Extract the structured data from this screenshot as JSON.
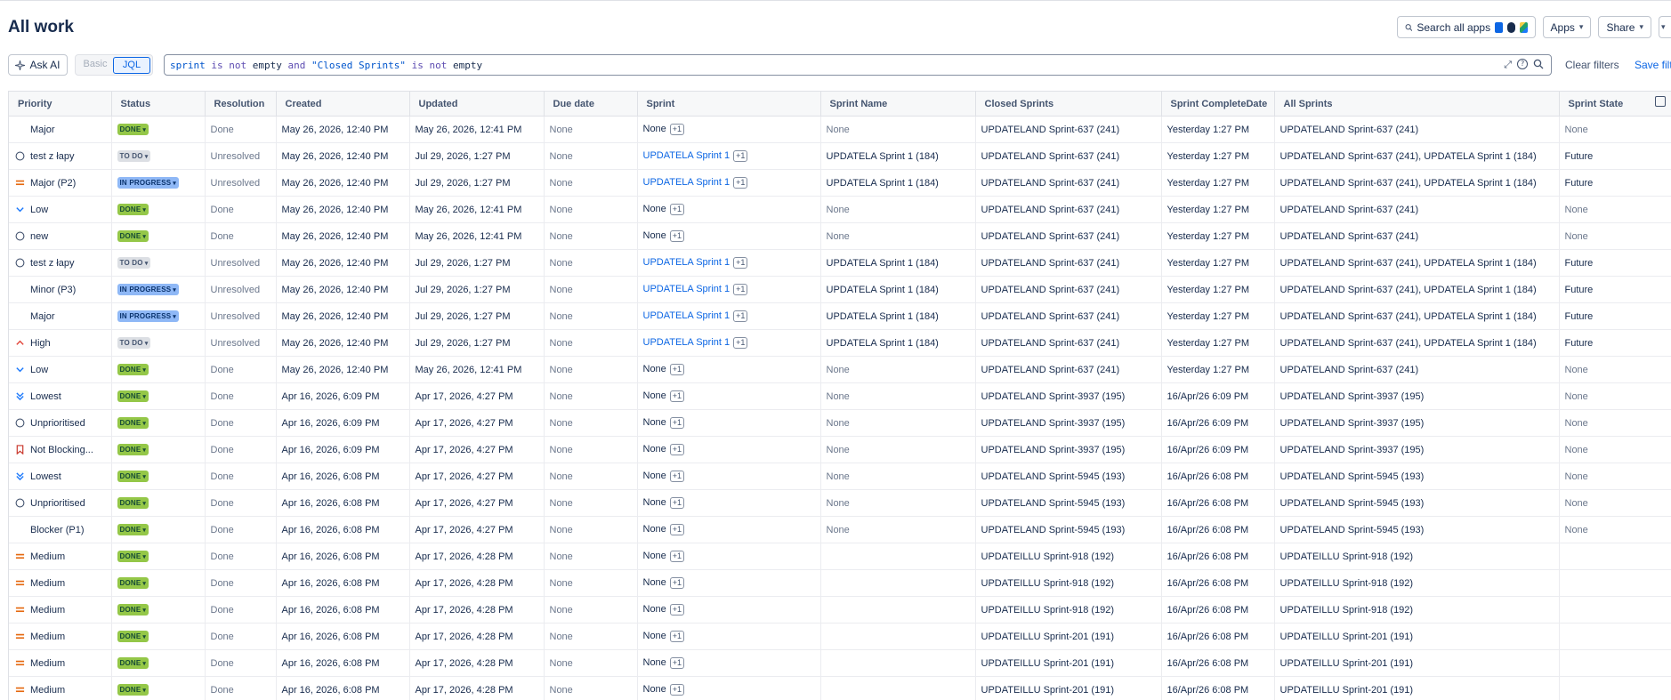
{
  "header": {
    "title": "All work"
  },
  "top_actions": {
    "search_label": "Search all apps",
    "apps_label": "Apps",
    "share_label": "Share"
  },
  "toolbar": {
    "ask_ai_label": "Ask AI",
    "basic_label": "Basic",
    "jql_label": "JQL",
    "query": {
      "t1": "sprint",
      "t2": "is not",
      "t3": "empty",
      "t4": "and",
      "t5": "\"Closed Sprints\"",
      "t6": "is not",
      "t7": "empty"
    },
    "clear_filters_label": "Clear filters",
    "save_filter_label": "Save filter"
  },
  "colors": {
    "accent": "#0c66e4",
    "done": "#94c748",
    "todo": "#dcdfe4",
    "in_progress": "#8fb8f6"
  },
  "table": {
    "columns": [
      "Priority",
      "Status",
      "Resolution",
      "Created",
      "Updated",
      "Due date",
      "Sprint",
      "Sprint Name",
      "Closed Sprints",
      "Sprint CompleteDate",
      "All Sprints",
      "Sprint State"
    ],
    "rows": [
      {
        "icon": "none",
        "priority": "Major",
        "status": "DONE",
        "resolution": "Done",
        "created": "May 26, 2026, 12:40 PM",
        "updated": "May 26, 2026, 12:41 PM",
        "due": "None",
        "sprint": "None",
        "sprint_more": "+1",
        "sprint_name": "None",
        "closed": "UPDATELAND Sprint-637 (241)",
        "complete": "Yesterday 1:27 PM",
        "all": "UPDATELAND Sprint-637 (241)",
        "state": "None"
      },
      {
        "icon": "circle",
        "priority": "test z łapy",
        "status": "TO DO",
        "resolution": "Unresolved",
        "created": "May 26, 2026, 12:40 PM",
        "updated": "Jul 29, 2026, 1:27 PM",
        "due": "None",
        "sprint": "UPDATELA Sprint 1",
        "sprint_more": "+1",
        "sprint_name": "UPDATELA Sprint 1 (184)",
        "closed": "UPDATELAND Sprint-637 (241)",
        "complete": "Yesterday 1:27 PM",
        "all": "UPDATELAND Sprint-637 (241), UPDATELA Sprint 1 (184)",
        "state": "Future"
      },
      {
        "icon": "medium",
        "priority": "Major (P2)",
        "status": "IN PROGRESS",
        "resolution": "Unresolved",
        "created": "May 26, 2026, 12:40 PM",
        "updated": "Jul 29, 2026, 1:27 PM",
        "due": "None",
        "sprint": "UPDATELA Sprint 1",
        "sprint_more": "+1",
        "sprint_name": "UPDATELA Sprint 1 (184)",
        "closed": "UPDATELAND Sprint-637 (241)",
        "complete": "Yesterday 1:27 PM",
        "all": "UPDATELAND Sprint-637 (241), UPDATELA Sprint 1 (184)",
        "state": "Future"
      },
      {
        "icon": "low",
        "priority": "Low",
        "status": "DONE",
        "resolution": "Done",
        "created": "May 26, 2026, 12:40 PM",
        "updated": "May 26, 2026, 12:41 PM",
        "due": "None",
        "sprint": "None",
        "sprint_more": "+1",
        "sprint_name": "None",
        "closed": "UPDATELAND Sprint-637 (241)",
        "complete": "Yesterday 1:27 PM",
        "all": "UPDATELAND Sprint-637 (241)",
        "state": "None"
      },
      {
        "icon": "circle",
        "priority": "new",
        "status": "DONE",
        "resolution": "Done",
        "created": "May 26, 2026, 12:40 PM",
        "updated": "May 26, 2026, 12:41 PM",
        "due": "None",
        "sprint": "None",
        "sprint_more": "+1",
        "sprint_name": "None",
        "closed": "UPDATELAND Sprint-637 (241)",
        "complete": "Yesterday 1:27 PM",
        "all": "UPDATELAND Sprint-637 (241)",
        "state": "None"
      },
      {
        "icon": "circle",
        "priority": "test z łapy",
        "status": "TO DO",
        "resolution": "Unresolved",
        "created": "May 26, 2026, 12:40 PM",
        "updated": "Jul 29, 2026, 1:27 PM",
        "due": "None",
        "sprint": "UPDATELA Sprint 1",
        "sprint_more": "+1",
        "sprint_name": "UPDATELA Sprint 1 (184)",
        "closed": "UPDATELAND Sprint-637 (241)",
        "complete": "Yesterday 1:27 PM",
        "all": "UPDATELAND Sprint-637 (241), UPDATELA Sprint 1 (184)",
        "state": "Future"
      },
      {
        "icon": "none",
        "priority": "Minor (P3)",
        "status": "IN PROGRESS",
        "resolution": "Unresolved",
        "created": "May 26, 2026, 12:40 PM",
        "updated": "Jul 29, 2026, 1:27 PM",
        "due": "None",
        "sprint": "UPDATELA Sprint 1",
        "sprint_more": "+1",
        "sprint_name": "UPDATELA Sprint 1 (184)",
        "closed": "UPDATELAND Sprint-637 (241)",
        "complete": "Yesterday 1:27 PM",
        "all": "UPDATELAND Sprint-637 (241), UPDATELA Sprint 1 (184)",
        "state": "Future"
      },
      {
        "icon": "none",
        "priority": "Major",
        "status": "IN PROGRESS",
        "resolution": "Unresolved",
        "created": "May 26, 2026, 12:40 PM",
        "updated": "Jul 29, 2026, 1:27 PM",
        "due": "None",
        "sprint": "UPDATELA Sprint 1",
        "sprint_more": "+1",
        "sprint_name": "UPDATELA Sprint 1 (184)",
        "closed": "UPDATELAND Sprint-637 (241)",
        "complete": "Yesterday 1:27 PM",
        "all": "UPDATELAND Sprint-637 (241), UPDATELA Sprint 1 (184)",
        "state": "Future"
      },
      {
        "icon": "high",
        "priority": "High",
        "status": "TO DO",
        "resolution": "Unresolved",
        "created": "May 26, 2026, 12:40 PM",
        "updated": "Jul 29, 2026, 1:27 PM",
        "due": "None",
        "sprint": "UPDATELA Sprint 1",
        "sprint_more": "+1",
        "sprint_name": "UPDATELA Sprint 1 (184)",
        "closed": "UPDATELAND Sprint-637 (241)",
        "complete": "Yesterday 1:27 PM",
        "all": "UPDATELAND Sprint-637 (241), UPDATELA Sprint 1 (184)",
        "state": "Future"
      },
      {
        "icon": "low",
        "priority": "Low",
        "status": "DONE",
        "resolution": "Done",
        "created": "May 26, 2026, 12:40 PM",
        "updated": "May 26, 2026, 12:41 PM",
        "due": "None",
        "sprint": "None",
        "sprint_more": "+1",
        "sprint_name": "None",
        "closed": "UPDATELAND Sprint-637 (241)",
        "complete": "Yesterday 1:27 PM",
        "all": "UPDATELAND Sprint-637 (241)",
        "state": "None"
      },
      {
        "icon": "lowest",
        "priority": "Lowest",
        "status": "DONE",
        "resolution": "Done",
        "created": "Apr 16, 2026, 6:09 PM",
        "updated": "Apr 17, 2026, 4:27 PM",
        "due": "None",
        "sprint": "None",
        "sprint_more": "+1",
        "sprint_name": "None",
        "closed": "UPDATELAND Sprint-3937 (195)",
        "complete": "16/Apr/26 6:09 PM",
        "all": "UPDATELAND Sprint-3937 (195)",
        "state": "None"
      },
      {
        "icon": "circle",
        "priority": "Unprioritised",
        "status": "DONE",
        "resolution": "Done",
        "created": "Apr 16, 2026, 6:09 PM",
        "updated": "Apr 17, 2026, 4:27 PM",
        "due": "None",
        "sprint": "None",
        "sprint_more": "+1",
        "sprint_name": "None",
        "closed": "UPDATELAND Sprint-3937 (195)",
        "complete": "16/Apr/26 6:09 PM",
        "all": "UPDATELAND Sprint-3937 (195)",
        "state": "None"
      },
      {
        "icon": "blocking",
        "priority": "Not Blocking...",
        "status": "DONE",
        "resolution": "Done",
        "created": "Apr 16, 2026, 6:09 PM",
        "updated": "Apr 17, 2026, 4:27 PM",
        "due": "None",
        "sprint": "None",
        "sprint_more": "+1",
        "sprint_name": "None",
        "closed": "UPDATELAND Sprint-3937 (195)",
        "complete": "16/Apr/26 6:09 PM",
        "all": "UPDATELAND Sprint-3937 (195)",
        "state": "None"
      },
      {
        "icon": "lowest",
        "priority": "Lowest",
        "status": "DONE",
        "resolution": "Done",
        "created": "Apr 16, 2026, 6:08 PM",
        "updated": "Apr 17, 2026, 4:27 PM",
        "due": "None",
        "sprint": "None",
        "sprint_more": "+1",
        "sprint_name": "None",
        "closed": "UPDATELAND Sprint-5945 (193)",
        "complete": "16/Apr/26 6:08 PM",
        "all": "UPDATELAND Sprint-5945 (193)",
        "state": "None"
      },
      {
        "icon": "circle",
        "priority": "Unprioritised",
        "status": "DONE",
        "resolution": "Done",
        "created": "Apr 16, 2026, 6:08 PM",
        "updated": "Apr 17, 2026, 4:27 PM",
        "due": "None",
        "sprint": "None",
        "sprint_more": "+1",
        "sprint_name": "None",
        "closed": "UPDATELAND Sprint-5945 (193)",
        "complete": "16/Apr/26 6:08 PM",
        "all": "UPDATELAND Sprint-5945 (193)",
        "state": "None"
      },
      {
        "icon": "none",
        "priority": "Blocker (P1)",
        "status": "DONE",
        "resolution": "Done",
        "created": "Apr 16, 2026, 6:08 PM",
        "updated": "Apr 17, 2026, 4:27 PM",
        "due": "None",
        "sprint": "None",
        "sprint_more": "+1",
        "sprint_name": "None",
        "closed": "UPDATELAND Sprint-5945 (193)",
        "complete": "16/Apr/26 6:08 PM",
        "all": "UPDATELAND Sprint-5945 (193)",
        "state": "None"
      },
      {
        "icon": "medium",
        "priority": "Medium",
        "status": "DONE",
        "resolution": "Done",
        "created": "Apr 16, 2026, 6:08 PM",
        "updated": "Apr 17, 2026, 4:28 PM",
        "due": "None",
        "sprint": "None",
        "sprint_more": "+1",
        "sprint_name": "",
        "closed": "UPDATEILLU Sprint-918 (192)",
        "complete": "16/Apr/26 6:08 PM",
        "all": "UPDATEILLU Sprint-918 (192)",
        "state": ""
      },
      {
        "icon": "medium",
        "priority": "Medium",
        "status": "DONE",
        "resolution": "Done",
        "created": "Apr 16, 2026, 6:08 PM",
        "updated": "Apr 17, 2026, 4:28 PM",
        "due": "None",
        "sprint": "None",
        "sprint_more": "+1",
        "sprint_name": "",
        "closed": "UPDATEILLU Sprint-918 (192)",
        "complete": "16/Apr/26 6:08 PM",
        "all": "UPDATEILLU Sprint-918 (192)",
        "state": ""
      },
      {
        "icon": "medium",
        "priority": "Medium",
        "status": "DONE",
        "resolution": "Done",
        "created": "Apr 16, 2026, 6:08 PM",
        "updated": "Apr 17, 2026, 4:28 PM",
        "due": "None",
        "sprint": "None",
        "sprint_more": "+1",
        "sprint_name": "",
        "closed": "UPDATEILLU Sprint-918 (192)",
        "complete": "16/Apr/26 6:08 PM",
        "all": "UPDATEILLU Sprint-918 (192)",
        "state": ""
      },
      {
        "icon": "medium",
        "priority": "Medium",
        "status": "DONE",
        "resolution": "Done",
        "created": "Apr 16, 2026, 6:08 PM",
        "updated": "Apr 17, 2026, 4:28 PM",
        "due": "None",
        "sprint": "None",
        "sprint_more": "+1",
        "sprint_name": "",
        "closed": "UPDATEILLU Sprint-201 (191)",
        "complete": "16/Apr/26 6:08 PM",
        "all": "UPDATEILLU Sprint-201 (191)",
        "state": ""
      },
      {
        "icon": "medium",
        "priority": "Medium",
        "status": "DONE",
        "resolution": "Done",
        "created": "Apr 16, 2026, 6:08 PM",
        "updated": "Apr 17, 2026, 4:28 PM",
        "due": "None",
        "sprint": "None",
        "sprint_more": "+1",
        "sprint_name": "",
        "closed": "UPDATEILLU Sprint-201 (191)",
        "complete": "16/Apr/26 6:08 PM",
        "all": "UPDATEILLU Sprint-201 (191)",
        "state": ""
      },
      {
        "icon": "medium",
        "priority": "Medium",
        "status": "DONE",
        "resolution": "Done",
        "created": "Apr 16, 2026, 6:08 PM",
        "updated": "Apr 17, 2026, 4:28 PM",
        "due": "None",
        "sprint": "None",
        "sprint_more": "+1",
        "sprint_name": "",
        "closed": "UPDATEILLU Sprint-201 (191)",
        "complete": "16/Apr/26 6:08 PM",
        "all": "UPDATEILLU Sprint-201 (191)",
        "state": ""
      }
    ]
  }
}
